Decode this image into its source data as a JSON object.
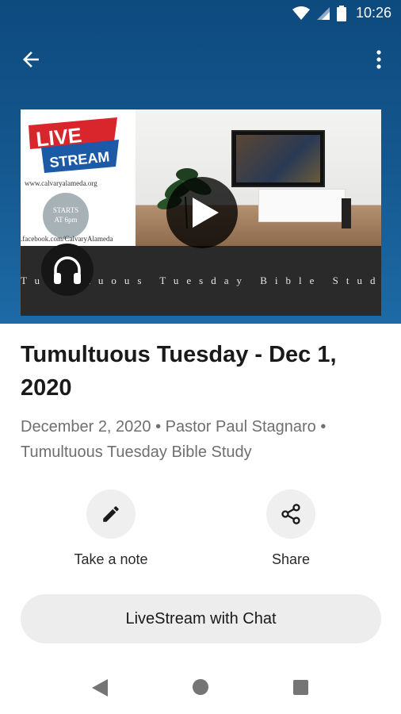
{
  "status_bar": {
    "time": "10:26"
  },
  "media": {
    "promo_live_word": "LIVE",
    "promo_stream_word": "STREAM",
    "promo_url": "www.calvaryalameda.org",
    "promo_starts_line1": "STARTS",
    "promo_starts_line2": "AT 6pm",
    "promo_facebook": ".facebook.com/CalvaryAlameda",
    "banner_text": "Tumultuous Tuesday Bible Study"
  },
  "sermon": {
    "title": "Tumultuous Tuesday - Dec 1, 2020",
    "meta": "December 2, 2020 • Pastor Paul Stagnaro • Tumultuous Tuesday Bible Study"
  },
  "actions": {
    "take_note_label": "Take a note",
    "share_label": "Share"
  },
  "livestream_button_label": "LiveStream with Chat",
  "colors": {
    "hero_blue": "#14568d",
    "button_grey": "#ededed"
  }
}
